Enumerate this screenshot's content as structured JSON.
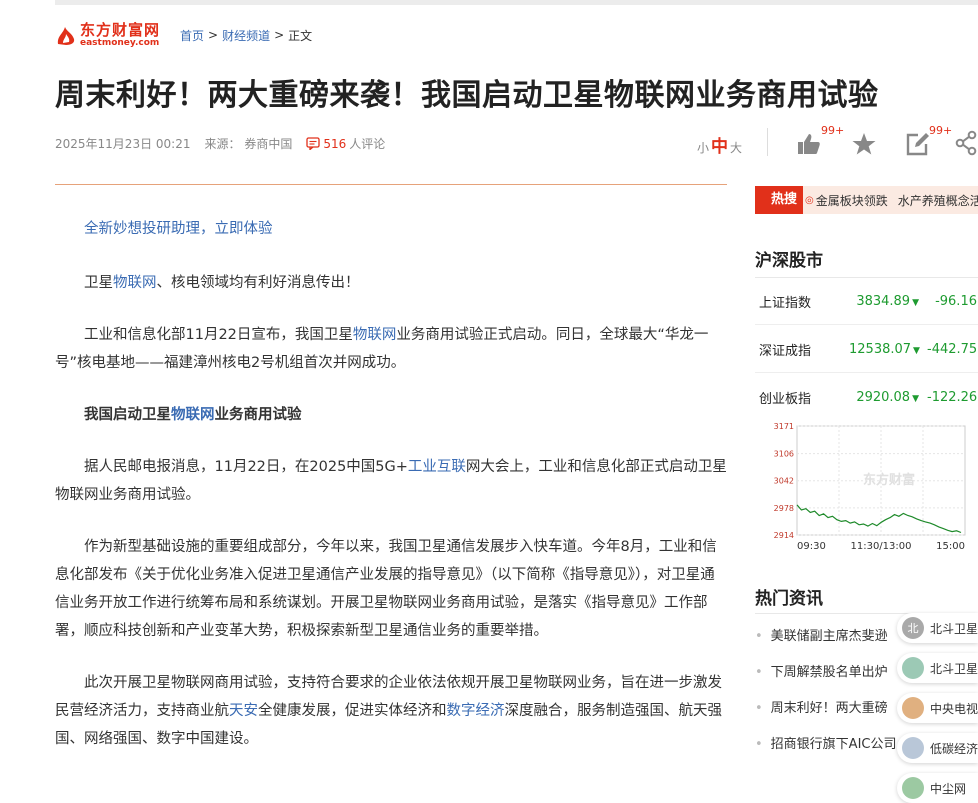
{
  "logo": {
    "cn": "东方财富网",
    "en": "eastmoney.com"
  },
  "breadcrumb": {
    "home": "首页",
    "sep1": ">",
    "channel": "财经频道",
    "sep2": ">",
    "current": "正文"
  },
  "article": {
    "title": "周末利好！两大重磅来袭！我国启动卫星物联网业务商用试验",
    "date": "2025年11月23日 00:21",
    "source_label": "来源：",
    "source_name": "券商中国",
    "comment_count": "516",
    "comment_suffix": "人评论",
    "fontsize": {
      "small": "小",
      "mid": "中",
      "large": "大"
    },
    "like_badge": "99+",
    "comment_badge": "99+",
    "promo": "全新妙想投研助理，立即体验",
    "p1": {
      "a": "卫星",
      "link": "物联网",
      "b": "、核电领域均有利好消息传出！"
    },
    "p2": {
      "a": "工业和信息化部11月22日宣布，我国卫星",
      "link": "物联网",
      "b": "业务商用试验正式启动。同日，全球最大“华龙一号”核电基地——福建漳州核电2号机组首次并网成功。"
    },
    "h1": {
      "a": "我国启动卫星",
      "link": "物联网",
      "b": "业务商用试验"
    },
    "p3": {
      "a": "据人民邮电报消息，11月22日，在2025中国5G+",
      "link": "工业互联",
      "b": "网大会上，工业和信息化部正式启动卫星物联网业务商用试验。"
    },
    "p4": "作为新型基础设施的重要组成部分，今年以来，我国卫星通信发展步入快车道。今年8月，工业和信息化部发布《关于优化业务准入促进卫星通信产业发展的指导意见》（以下简称《指导意见》），对卫星通信业务开放工作进行统筹布局和系统谋划。开展卫星物联网业务商用试验，是落实《指导意见》工作部署，顺应科技创新和产业变革大势，积极探索新型卫星通信业务的重要举措。",
    "p5": {
      "a": "此次开展卫星物联网商用试验，支持符合要求的企业依法依规开展卫星物联网业务，旨在进一步激发民营经济活力，支持商业航",
      "link1": "天安",
      "b": "全健康发展，促进实体经济和",
      "link2": "数字经济",
      "c": "深度融合，服务制造强国、航天强国、网络强国、数字中国建设。"
    }
  },
  "hot_search": {
    "tag": "热搜",
    "items": [
      "金属板块领跌",
      "水产养殖概念活跃"
    ]
  },
  "market": {
    "title": "沪深股市",
    "indices": [
      {
        "name": "上证指数",
        "value": "3834.89",
        "change": "-96.16"
      },
      {
        "name": "深证成指",
        "value": "12538.07",
        "change": "-442.75"
      },
      {
        "name": "创业板指",
        "value": "2920.08",
        "change": "-122.26"
      }
    ]
  },
  "chart_data": {
    "type": "line",
    "title": "",
    "watermark": "东方财富",
    "x_ticks": [
      "09:30",
      "11:30/13:00",
      "15:00"
    ],
    "y_ticks": [
      3171,
      3106,
      3042,
      2978,
      2914
    ],
    "ylim": [
      2914,
      3171
    ],
    "grid": true,
    "series": [
      {
        "values": [
          2985,
          2973,
          2976,
          2967,
          2970,
          2960,
          2964,
          2955,
          2958,
          2950,
          2946,
          2948,
          2942,
          2945,
          2938,
          2940,
          2935,
          2941,
          2936,
          2944,
          2950,
          2955,
          2962,
          2958,
          2965,
          2960,
          2957,
          2952,
          2948,
          2945,
          2942,
          2938,
          2933,
          2929,
          2925,
          2922,
          2924,
          2920
        ]
      }
    ]
  },
  "hot_news": {
    "title": "热门资讯",
    "items": [
      "美联储副主席杰斐逊",
      "下周解禁股名单出炉",
      "周末利好！两大重磅",
      "招商银行旗下AIC公司"
    ]
  },
  "recommend": [
    {
      "icon_label": "北",
      "text": "北斗卫星",
      "color": "#a9a9a9"
    },
    {
      "icon_label": "",
      "text": "北斗卫星",
      "color": "#9cc9b5"
    },
    {
      "icon_label": "",
      "text": "中央电视台",
      "color": "#e0b080"
    },
    {
      "icon_label": "",
      "text": "低碳经济",
      "color": "#b9c7d8"
    },
    {
      "icon_label": "",
      "text": "中尘网",
      "color": "#9cc9a2"
    }
  ]
}
